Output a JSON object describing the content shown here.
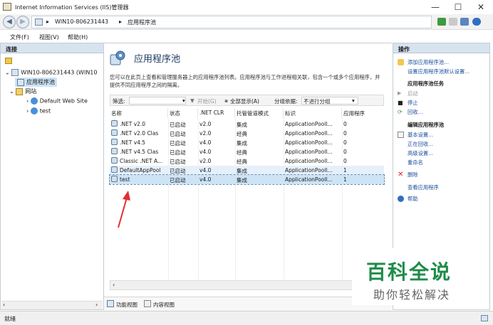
{
  "window": {
    "title": "Internet Information Services (IIS)管理器",
    "minimize": "—",
    "maximize": "☐",
    "close": "✕"
  },
  "address": {
    "server": "WIN10-806231443",
    "page": "应用程序池",
    "sep": "▸"
  },
  "menu": {
    "file": "文件(F)",
    "view": "视图(V)",
    "help": "帮助(H)"
  },
  "connections": {
    "title": "连接",
    "tree": {
      "server": "WIN10-806231443 (WIN10",
      "app_pools": "应用程序池",
      "sites": "网站",
      "site1": "Default Web Site",
      "site2": "test"
    }
  },
  "main": {
    "title": "应用程序池",
    "description": "您可以在此页上查看和管理服务器上的应用程序池列表。应用程序池与工作进程相关联，包含一个或多个应用程序，并提供不同应用程序之间的隔离。",
    "filter": {
      "label": "筛选:",
      "start": "开始(G)",
      "show_all": "全部显示(A)",
      "group_by": "分组依据:",
      "group_value": "不进行分组"
    },
    "columns": [
      "名称",
      "状态",
      ".NET CLR",
      "托管管道模式",
      "标识",
      "应用程序"
    ],
    "rows": [
      {
        "name": ".NET v2.0",
        "status": "已启动",
        "clr": "v2.0",
        "pipeline": "集成",
        "identity": "ApplicationPooll...",
        "apps": "0"
      },
      {
        "name": ".NET v2.0 Clas",
        "status": "已启动",
        "clr": "v2.0",
        "pipeline": "经典",
        "identity": "ApplicationPooll...",
        "apps": "0"
      },
      {
        "name": ".NET v4.5",
        "status": "已启动",
        "clr": "v4.0",
        "pipeline": "集成",
        "identity": "ApplicationPooll...",
        "apps": "0"
      },
      {
        "name": ".NET v4.5 Clas",
        "status": "已启动",
        "clr": "v4.0",
        "pipeline": "经典",
        "identity": "ApplicationPooll...",
        "apps": "0"
      },
      {
        "name": "Classic .NET A...",
        "status": "已启动",
        "clr": "v2.0",
        "pipeline": "经典",
        "identity": "ApplicationPooll...",
        "apps": "0"
      },
      {
        "name": "DefaultAppPool",
        "status": "已启动",
        "clr": "v4.0",
        "pipeline": "集成",
        "identity": "ApplicationPooll...",
        "apps": "1"
      },
      {
        "name": "test",
        "status": "已启动",
        "clr": "v4.0",
        "pipeline": "集成",
        "identity": "ApplicationPooll...",
        "apps": "1"
      }
    ],
    "tabs": {
      "features": "功能视图",
      "content": "内容视图"
    }
  },
  "actions": {
    "title": "操作",
    "add_pool": "添加应用程序池...",
    "set_defaults": "设置应用程序池默认设置...",
    "tasks_header": "应用程序池任务",
    "start": "启动",
    "stop": "停止",
    "recycle": "回收...",
    "edit_header": "编辑应用程序池",
    "basic": "基本设置...",
    "recycling": "正在回收...",
    "advanced": "高级设置...",
    "rename": "重命名",
    "delete": "删除",
    "view_apps": "查看应用程序",
    "help": "帮助"
  },
  "status": {
    "text": "就绪"
  },
  "watermark": {
    "title": "百科全说",
    "subtitle": "助你轻松解决"
  },
  "colors": {
    "accent": "#1e8c4a",
    "selection": "#cde4f7",
    "arrow": "#e03030",
    "header_pane": "#d7e3ef"
  }
}
